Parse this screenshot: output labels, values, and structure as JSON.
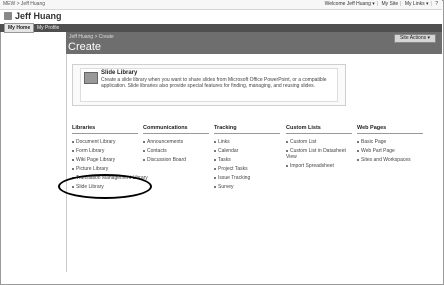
{
  "top": {
    "crumb": "MEW > Jeff Huang",
    "welcome": "Welcome Jeff Huang ▾",
    "my_site": "My Site",
    "my_links": "My Links ▾",
    "help": "?"
  },
  "site": {
    "title": "Jeff Huang"
  },
  "nav": {
    "tabs": [
      "My Home",
      "My Profile"
    ]
  },
  "page": {
    "breadcrumb": "Jeff Huang > Create",
    "title": "Create",
    "site_actions": "Site Actions ▾"
  },
  "description": {
    "title": "Slide Library",
    "text": "Create a slide library when you want to share slides from Microsoft Office PowerPoint, or a compatible application. Slide libraries also provide special features for finding, managing, and reusing slides."
  },
  "columns": [
    {
      "heading": "Libraries",
      "items": [
        "Document Library",
        "Form Library",
        "Wiki Page Library",
        "Picture Library",
        "Translation Management Library",
        "Slide Library"
      ]
    },
    {
      "heading": "Communications",
      "items": [
        "Announcements",
        "Contacts",
        "Discussion Board"
      ]
    },
    {
      "heading": "Tracking",
      "items": [
        "Links",
        "Calendar",
        "Tasks",
        "Project Tasks",
        "Issue Tracking",
        "Survey"
      ]
    },
    {
      "heading": "Custom Lists",
      "items": [
        "Custom List",
        "Custom List in Datasheet View",
        "Import Spreadsheet"
      ]
    },
    {
      "heading": "Web Pages",
      "items": [
        "Basic Page",
        "Web Part Page",
        "Sites and Workspaces"
      ]
    }
  ],
  "colors": {
    "nav_bar": "#4f4f4f",
    "title_band": "#6e6e6e",
    "highlight": "#000000"
  }
}
